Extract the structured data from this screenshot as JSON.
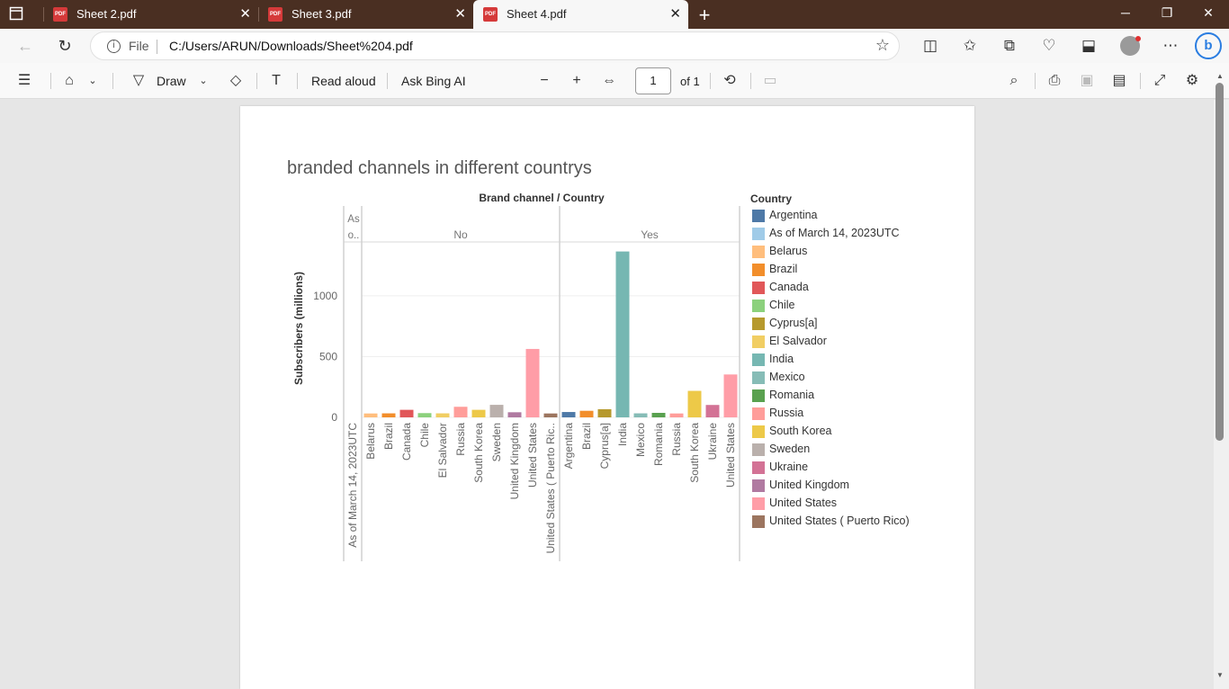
{
  "browser": {
    "tabs": [
      {
        "title": "Sheet 2.pdf",
        "active": false
      },
      {
        "title": "Sheet 3.pdf",
        "active": false
      },
      {
        "title": "Sheet 4.pdf",
        "active": true
      }
    ],
    "new_tab": "+",
    "address": {
      "scheme_label": "File",
      "url": "C:/Users/ARUN/Downloads/Sheet%204.pdf"
    }
  },
  "pdf_toolbar": {
    "draw_label": "Draw",
    "read_aloud_label": "Read aloud",
    "ask_bing_label": "Ask Bing AI",
    "page_number": "1",
    "page_of": "of 1"
  },
  "chart_data": {
    "type": "bar",
    "title": "branded channels in different countrys",
    "header": "Brand channel  /  Country",
    "ylabel": "Subscribers (millions)",
    "yticks": [
      0,
      500,
      1000
    ],
    "ylim": [
      0,
      1400
    ],
    "panels": [
      {
        "label": "As o..",
        "bars": [
          {
            "country": "As of March 14, 2023UTC",
            "value": 0
          }
        ]
      },
      {
        "label": "No",
        "bars": [
          {
            "country": "Belarus",
            "value": 32
          },
          {
            "country": "Brazil",
            "value": 33
          },
          {
            "country": "Canada",
            "value": 62
          },
          {
            "country": "Chile",
            "value": 35
          },
          {
            "country": "El Salvador",
            "value": 33
          },
          {
            "country": "Russia",
            "value": 87
          },
          {
            "country": "South Korea",
            "value": 62
          },
          {
            "country": "Sweden",
            "value": 103
          },
          {
            "country": "United Kingdom",
            "value": 42
          },
          {
            "country": "United States",
            "value": 563
          },
          {
            "country": "United States ( Puerto Ric..",
            "value": 32
          }
        ]
      },
      {
        "label": "Yes",
        "bars": [
          {
            "country": "Argentina",
            "value": 44
          },
          {
            "country": "Brazil",
            "value": 54
          },
          {
            "country": "Cyprus[a]",
            "value": 67
          },
          {
            "country": "India",
            "value": 1365
          },
          {
            "country": "Mexico",
            "value": 33
          },
          {
            "country": "Romania",
            "value": 37
          },
          {
            "country": "Russia",
            "value": 32
          },
          {
            "country": "South Korea",
            "value": 218
          },
          {
            "country": "Ukraine",
            "value": 102
          },
          {
            "country": "United States",
            "value": 353
          }
        ]
      }
    ],
    "legend": {
      "title": "Country",
      "items": [
        {
          "name": "Argentina",
          "color": "#4e79a7"
        },
        {
          "name": "As of March 14, 2023UTC",
          "color": "#a0cbe8"
        },
        {
          "name": "Belarus",
          "color": "#ffbe7d"
        },
        {
          "name": "Brazil",
          "color": "#f28e2b"
        },
        {
          "name": "Canada",
          "color": "#e15759"
        },
        {
          "name": "Chile",
          "color": "#8cd17d"
        },
        {
          "name": "Cyprus[a]",
          "color": "#b6992d"
        },
        {
          "name": "El Salvador",
          "color": "#f1ce63"
        },
        {
          "name": "India",
          "color": "#76b7b2"
        },
        {
          "name": "Mexico",
          "color": "#86bcb6"
        },
        {
          "name": "Romania",
          "color": "#59a14f"
        },
        {
          "name": "Russia",
          "color": "#ff9d9a"
        },
        {
          "name": "South Korea",
          "color": "#edc948"
        },
        {
          "name": "Sweden",
          "color": "#bab0ac"
        },
        {
          "name": "Ukraine",
          "color": "#d37295"
        },
        {
          "name": "United Kingdom",
          "color": "#b07aa1"
        },
        {
          "name": "United States",
          "color": "#ff9da7"
        },
        {
          "name": "United States ( Puerto Rico)",
          "color": "#9c755f"
        }
      ]
    }
  }
}
